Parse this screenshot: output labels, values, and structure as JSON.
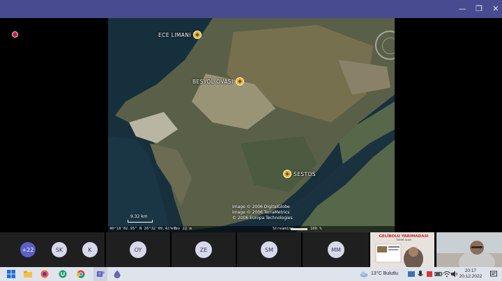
{
  "window": {
    "minimize_glyph": "—",
    "maximize_glyph": "❐",
    "close_glyph": "✕"
  },
  "map": {
    "places": [
      {
        "name": "ECE LIMANI"
      },
      {
        "name": "BESYOL OVASI"
      },
      {
        "name": "SESTOS"
      }
    ],
    "scale": "9.32 km",
    "copyright": [
      "Image © 2006 DigitalGlobe",
      "Image © 2006 TerraMetrics",
      "© 2006 Europa Technologies"
    ],
    "status": {
      "coords": "40°18'02.95\" N  26°32'09.42\" E",
      "elev": "elev  22 m",
      "streaming": "Streaming",
      "percent": "100 %"
    }
  },
  "participants": {
    "more": "+22",
    "avatars": [
      "SK",
      "K",
      "OY",
      "ZE",
      "SM",
      "MM"
    ],
    "slide": {
      "title": "GELİBOLU YARIMADASI",
      "subtitle": "TARİHİ ALAN"
    }
  },
  "taskbar": {
    "weather": "13°C  Bulutlu",
    "time": "20:17",
    "date": "20.12.2022"
  },
  "colors": {
    "titlebar": "#484b8f",
    "teams_purple": "#5b5fc7",
    "pin_gold": "#e6b53c"
  }
}
